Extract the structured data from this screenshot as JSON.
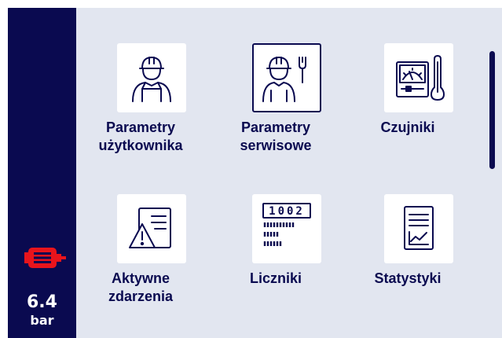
{
  "status": {
    "pressure_value": "6.4",
    "pressure_unit": "bar",
    "motor_icon": "motor-icon",
    "motor_color": "#e8141c"
  },
  "menu": {
    "items": [
      {
        "line1": "Parametry",
        "line2": "użytkownika",
        "icon": "worker-icon",
        "selected": false
      },
      {
        "line1": "Parametry",
        "line2": "serwisowe",
        "icon": "service-worker-wrench-icon",
        "selected": true
      },
      {
        "line1": "Czujniki",
        "line2": "",
        "icon": "gauge-thermometer-icon",
        "selected": false
      },
      {
        "line1": "Aktywne",
        "line2": "zdarzenia",
        "icon": "warning-document-icon",
        "selected": false
      },
      {
        "line1": "Liczniki",
        "line2": "",
        "icon": "counter-icon",
        "counter_digits": "1002",
        "selected": false
      },
      {
        "line1": "Statystyki",
        "line2": "",
        "icon": "statistics-report-icon",
        "selected": false
      }
    ]
  },
  "colors": {
    "sidebar": "#0a0a50",
    "content_bg": "#e2e6f0",
    "text": "#0a0a50",
    "accent": "#e8141c"
  }
}
